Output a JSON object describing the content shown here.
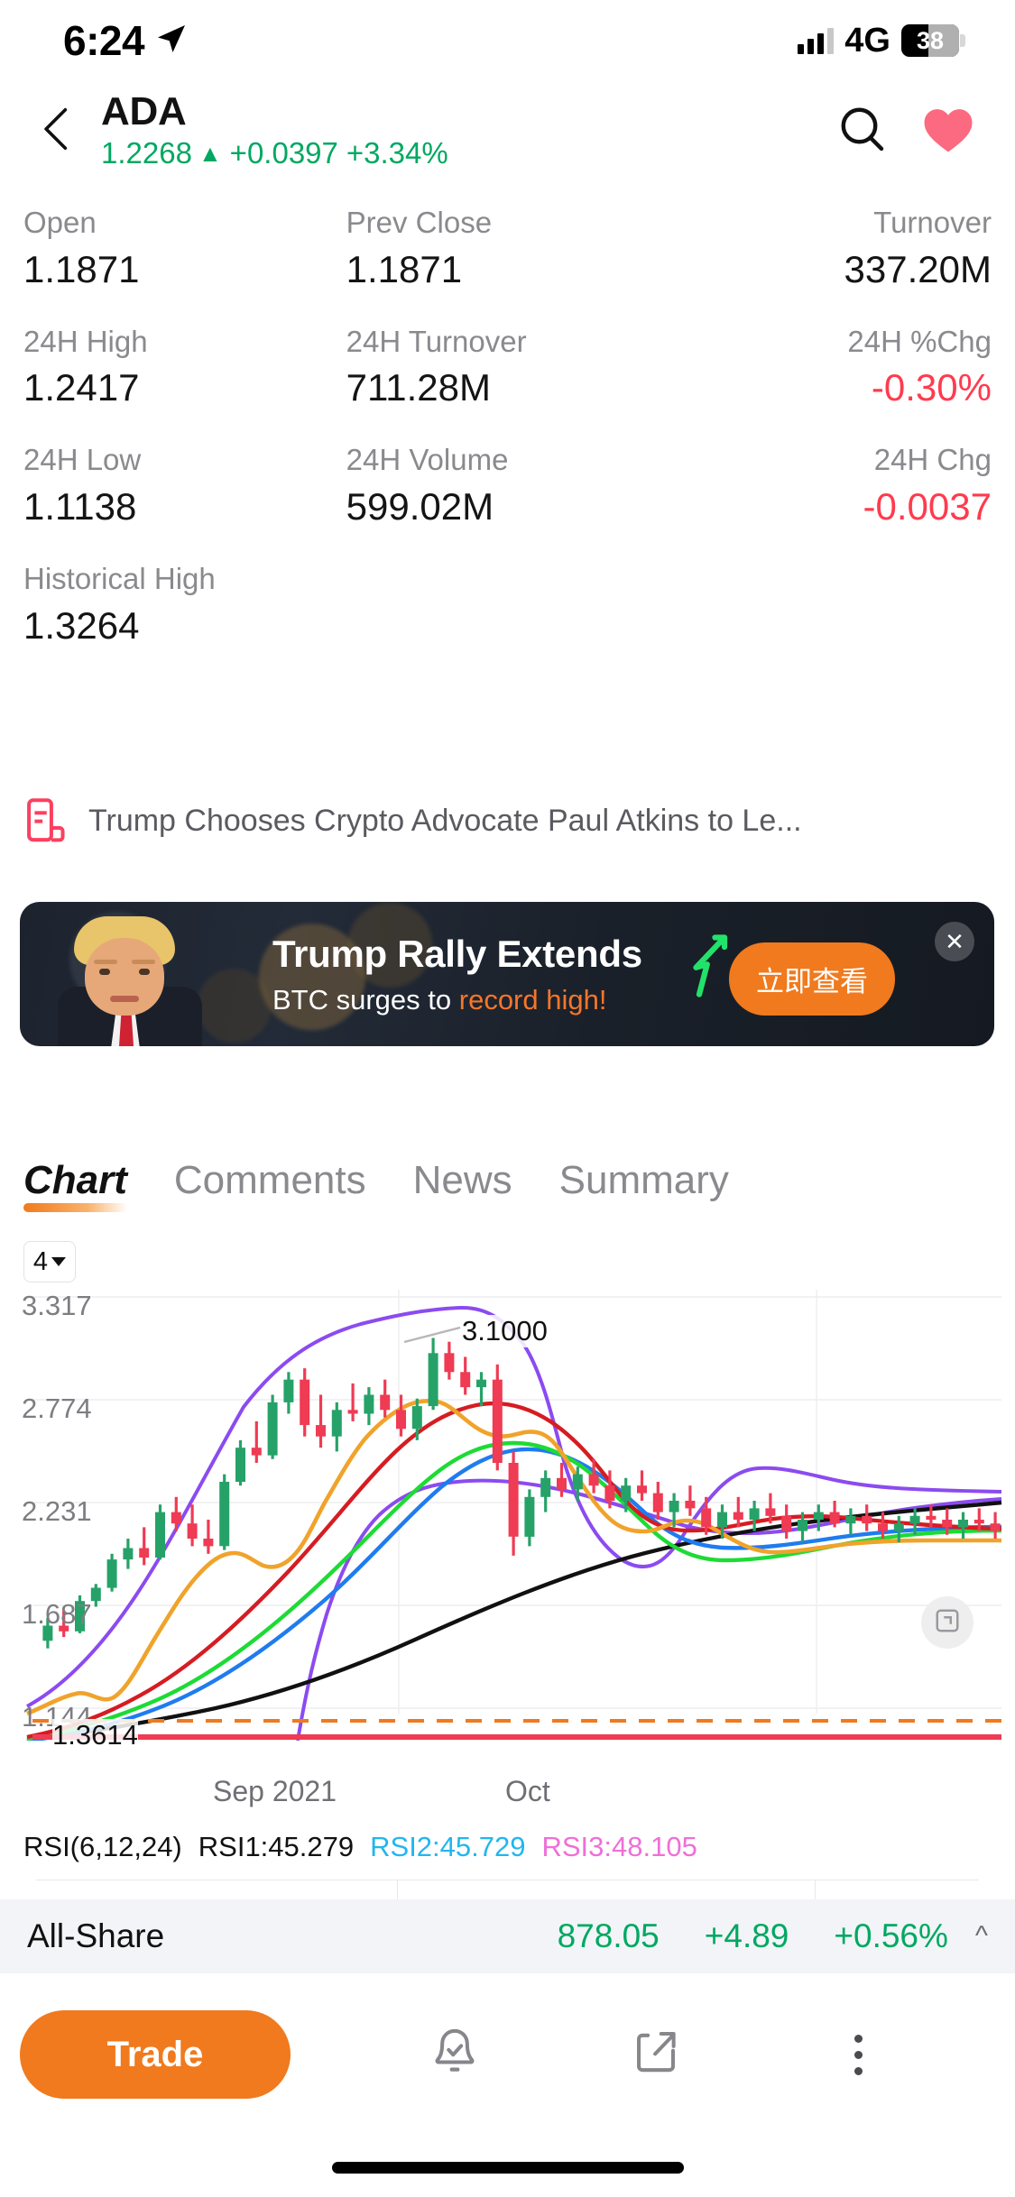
{
  "status_bar": {
    "time": "6:24",
    "location_icon": "location-arrow-icon",
    "network": "4G",
    "battery": "38"
  },
  "header": {
    "back_icon": "chevron-left-icon",
    "symbol": "ADA",
    "price": "1.2268",
    "direction_arrow": "▲",
    "change": "+0.0397",
    "change_percent": "+3.34%",
    "price_color": "#00a862",
    "search_icon": "search-icon",
    "favorite_icon": "heart-icon",
    "favorite_color": "#fb6a80"
  },
  "stats": [
    [
      {
        "label": "Open",
        "value": "1.1871",
        "tone": "neutral"
      },
      {
        "label": "Prev Close",
        "value": "1.1871",
        "tone": "neutral"
      },
      {
        "label": "Turnover",
        "value": "337.20M",
        "tone": "neutral"
      }
    ],
    [
      {
        "label": "24H High",
        "value": "1.2417",
        "tone": "neutral"
      },
      {
        "label": "24H Turnover",
        "value": "711.28M",
        "tone": "neutral"
      },
      {
        "label": "24H %Chg",
        "value": "-0.30%",
        "tone": "down"
      }
    ],
    [
      {
        "label": "24H Low",
        "value": "1.1138",
        "tone": "neutral"
      },
      {
        "label": "24H Volume",
        "value": "599.02M",
        "tone": "neutral"
      },
      {
        "label": "24H Chg",
        "value": "-0.0037",
        "tone": "down"
      }
    ],
    [
      {
        "label": "Historical High",
        "value": "1.3264",
        "tone": "neutral"
      },
      {
        "label": "",
        "value": "",
        "tone": "neutral"
      },
      {
        "label": "",
        "value": "",
        "tone": "neutral"
      }
    ]
  ],
  "news": {
    "icon": "news-document-icon",
    "headline": "Trump Chooses Crypto Advocate Paul Atkins to Le..."
  },
  "ad": {
    "title": "Trump Rally Extends",
    "subtitle_plain": "BTC surges to ",
    "subtitle_highlight": "record high!",
    "cta_label": "立即查看",
    "close_icon": "close-icon",
    "arrow_icon": "trend-up-arrow-icon",
    "cta_color": "#f07a1d",
    "highlight_color": "#f5762a"
  },
  "tabs": [
    {
      "label": "Chart",
      "active": true
    },
    {
      "label": "Comments",
      "active": false
    },
    {
      "label": "News",
      "active": false
    },
    {
      "label": "Summary",
      "active": false
    }
  ],
  "chart_controls": {
    "timeframe": "4",
    "dropdown_icon": "chevron-down-icon",
    "expand_icon": "expand-icon"
  },
  "indicator_row": {
    "name": "RSI(6,12,24)",
    "rsi1_label": "RSI1:45.279",
    "rsi2_label": "RSI2:45.729",
    "rsi3_label": "RSI3:48.105",
    "rsi1_color": "#111111",
    "rsi2_color": "#21b6ef",
    "rsi3_color": "#ef6fd8"
  },
  "index_bar": {
    "name": "All-Share",
    "value": "878.05",
    "change": "+4.89",
    "change_percent": "+0.56%",
    "collapse_icon": "chevron-up-icon",
    "color": "#00a862"
  },
  "toolbar": {
    "trade_label": "Trade",
    "alert_icon": "bell-check-icon",
    "share_icon": "share-icon",
    "more_icon": "more-vertical-icon"
  },
  "chart_data": {
    "type": "line",
    "title": "",
    "xlabel": "",
    "ylabel": "",
    "ylim": [
      1.144,
      3.317
    ],
    "y_ticks": [
      "3.317",
      "2.774",
      "2.231",
      "1.687",
      "1.144"
    ],
    "x_ticks": [
      "Sep 2021",
      "Oct"
    ],
    "grid": true,
    "annotations": [
      {
        "text": "3.1000",
        "type": "high-marker"
      },
      {
        "text": "1.3614",
        "type": "last-price-marker"
      }
    ],
    "series": [
      {
        "name": "Candles",
        "color": "#26a269/#ef3b53",
        "type": "candlestick"
      },
      {
        "name": "MA-orange",
        "color": "#f0a32b",
        "type": "line"
      },
      {
        "name": "MA-purple",
        "color": "#8b4bf0",
        "type": "line"
      },
      {
        "name": "MA-red",
        "color": "#d61c22",
        "type": "line"
      },
      {
        "name": "MA-blue",
        "color": "#1f7cf0",
        "type": "line"
      },
      {
        "name": "MA-green",
        "color": "#1ddb35",
        "type": "line"
      },
      {
        "name": "MA-black",
        "color": "#000000",
        "type": "line"
      },
      {
        "name": "support-dashed",
        "color": "#f07a1d",
        "type": "dashed-line"
      },
      {
        "name": "floor-line",
        "color": "#ef3b53",
        "type": "line"
      }
    ],
    "candles": [
      {
        "o": 1.5,
        "h": 1.62,
        "l": 1.46,
        "c": 1.58,
        "up": true
      },
      {
        "o": 1.58,
        "h": 1.66,
        "l": 1.52,
        "c": 1.55,
        "up": false
      },
      {
        "o": 1.55,
        "h": 1.74,
        "l": 1.54,
        "c": 1.71,
        "up": true
      },
      {
        "o": 1.71,
        "h": 1.8,
        "l": 1.68,
        "c": 1.78,
        "up": true
      },
      {
        "o": 1.78,
        "h": 1.96,
        "l": 1.76,
        "c": 1.93,
        "up": true
      },
      {
        "o": 1.93,
        "h": 2.04,
        "l": 1.88,
        "c": 1.99,
        "up": true
      },
      {
        "o": 1.99,
        "h": 2.1,
        "l": 1.9,
        "c": 1.94,
        "up": false
      },
      {
        "o": 1.94,
        "h": 2.22,
        "l": 1.93,
        "c": 2.18,
        "up": true
      },
      {
        "o": 2.18,
        "h": 2.26,
        "l": 2.08,
        "c": 2.12,
        "up": false
      },
      {
        "o": 2.12,
        "h": 2.22,
        "l": 2.0,
        "c": 2.04,
        "up": false
      },
      {
        "o": 2.04,
        "h": 2.14,
        "l": 1.96,
        "c": 2.0,
        "up": false
      },
      {
        "o": 2.0,
        "h": 2.38,
        "l": 1.98,
        "c": 2.34,
        "up": true
      },
      {
        "o": 2.34,
        "h": 2.56,
        "l": 2.32,
        "c": 2.52,
        "up": true
      },
      {
        "o": 2.52,
        "h": 2.66,
        "l": 2.44,
        "c": 2.48,
        "up": false
      },
      {
        "o": 2.48,
        "h": 2.8,
        "l": 2.46,
        "c": 2.76,
        "up": true
      },
      {
        "o": 2.76,
        "h": 2.92,
        "l": 2.7,
        "c": 2.88,
        "up": true
      },
      {
        "o": 2.88,
        "h": 2.94,
        "l": 2.58,
        "c": 2.64,
        "up": false
      },
      {
        "o": 2.64,
        "h": 2.8,
        "l": 2.52,
        "c": 2.58,
        "up": false
      },
      {
        "o": 2.58,
        "h": 2.76,
        "l": 2.5,
        "c": 2.72,
        "up": true
      },
      {
        "o": 2.72,
        "h": 2.86,
        "l": 2.66,
        "c": 2.7,
        "up": false
      },
      {
        "o": 2.7,
        "h": 2.84,
        "l": 2.64,
        "c": 2.8,
        "up": true
      },
      {
        "o": 2.8,
        "h": 2.88,
        "l": 2.68,
        "c": 2.72,
        "up": false
      },
      {
        "o": 2.72,
        "h": 2.8,
        "l": 2.58,
        "c": 2.62,
        "up": false
      },
      {
        "o": 2.62,
        "h": 2.78,
        "l": 2.56,
        "c": 2.74,
        "up": true
      },
      {
        "o": 2.74,
        "h": 3.1,
        "l": 2.72,
        "c": 3.02,
        "up": true
      },
      {
        "o": 3.02,
        "h": 3.08,
        "l": 2.88,
        "c": 2.92,
        "up": false
      },
      {
        "o": 2.92,
        "h": 3.0,
        "l": 2.8,
        "c": 2.84,
        "up": false
      },
      {
        "o": 2.84,
        "h": 2.92,
        "l": 2.74,
        "c": 2.88,
        "up": true
      },
      {
        "o": 2.88,
        "h": 2.96,
        "l": 2.4,
        "c": 2.44,
        "up": false
      },
      {
        "o": 2.44,
        "h": 2.5,
        "l": 1.95,
        "c": 2.05,
        "up": false
      },
      {
        "o": 2.05,
        "h": 2.3,
        "l": 2.0,
        "c": 2.26,
        "up": true
      },
      {
        "o": 2.26,
        "h": 2.4,
        "l": 2.18,
        "c": 2.36,
        "up": true
      },
      {
        "o": 2.36,
        "h": 2.44,
        "l": 2.26,
        "c": 2.3,
        "up": false
      },
      {
        "o": 2.3,
        "h": 2.42,
        "l": 2.24,
        "c": 2.38,
        "up": true
      },
      {
        "o": 2.38,
        "h": 2.46,
        "l": 2.28,
        "c": 2.32,
        "up": false
      },
      {
        "o": 2.32,
        "h": 2.4,
        "l": 2.2,
        "c": 2.24,
        "up": false
      },
      {
        "o": 2.24,
        "h": 2.36,
        "l": 2.18,
        "c": 2.32,
        "up": true
      },
      {
        "o": 2.32,
        "h": 2.4,
        "l": 2.24,
        "c": 2.28,
        "up": false
      },
      {
        "o": 2.28,
        "h": 2.34,
        "l": 2.14,
        "c": 2.18,
        "up": false
      },
      {
        "o": 2.18,
        "h": 2.28,
        "l": 2.1,
        "c": 2.24,
        "up": true
      },
      {
        "o": 2.24,
        "h": 2.32,
        "l": 2.16,
        "c": 2.2,
        "up": false
      },
      {
        "o": 2.2,
        "h": 2.26,
        "l": 2.06,
        "c": 2.1,
        "up": false
      },
      {
        "o": 2.1,
        "h": 2.22,
        "l": 2.04,
        "c": 2.18,
        "up": true
      },
      {
        "o": 2.18,
        "h": 2.26,
        "l": 2.1,
        "c": 2.14,
        "up": false
      },
      {
        "o": 2.14,
        "h": 2.24,
        "l": 2.08,
        "c": 2.2,
        "up": true
      },
      {
        "o": 2.2,
        "h": 2.28,
        "l": 2.12,
        "c": 2.16,
        "up": false
      },
      {
        "o": 2.16,
        "h": 2.22,
        "l": 2.04,
        "c": 2.08,
        "up": false
      },
      {
        "o": 2.08,
        "h": 2.18,
        "l": 2.02,
        "c": 2.14,
        "up": true
      },
      {
        "o": 2.14,
        "h": 2.22,
        "l": 2.08,
        "c": 2.18,
        "up": true
      },
      {
        "o": 2.18,
        "h": 2.24,
        "l": 2.1,
        "c": 2.12,
        "up": false
      },
      {
        "o": 2.12,
        "h": 2.2,
        "l": 2.06,
        "c": 2.16,
        "up": true
      },
      {
        "o": 2.16,
        "h": 2.22,
        "l": 2.08,
        "c": 2.12,
        "up": false
      },
      {
        "o": 2.12,
        "h": 2.18,
        "l": 2.04,
        "c": 2.08,
        "up": false
      },
      {
        "o": 2.08,
        "h": 2.16,
        "l": 2.02,
        "c": 2.12,
        "up": true
      },
      {
        "o": 2.12,
        "h": 2.2,
        "l": 2.06,
        "c": 2.16,
        "up": true
      },
      {
        "o": 2.16,
        "h": 2.22,
        "l": 2.1,
        "c": 2.14,
        "up": false
      },
      {
        "o": 2.14,
        "h": 2.2,
        "l": 2.06,
        "c": 2.1,
        "up": false
      },
      {
        "o": 2.1,
        "h": 2.18,
        "l": 2.04,
        "c": 2.14,
        "up": true
      },
      {
        "o": 2.14,
        "h": 2.2,
        "l": 2.08,
        "c": 2.12,
        "up": false
      },
      {
        "o": 2.12,
        "h": 2.18,
        "l": 2.04,
        "c": 2.08,
        "up": false
      }
    ]
  }
}
